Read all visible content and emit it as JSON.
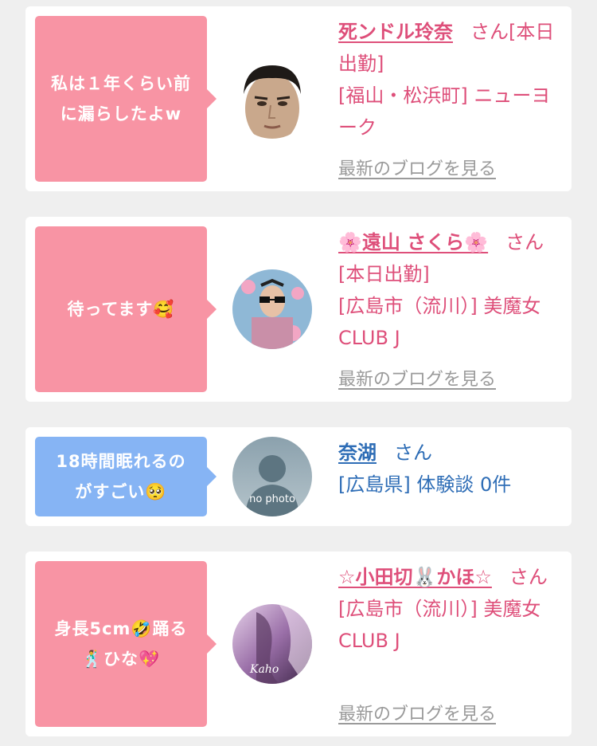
{
  "cards": [
    {
      "message": "私は１年くらい前\nに漏らしたよw",
      "name": "死ンドル玲奈",
      "honorific": "さん",
      "status": "[本日出勤]",
      "location": "[福山・松浜町] ニューヨーク",
      "blog_link": "最新のブログを見る"
    },
    {
      "message": "待ってます🥰",
      "name": "🌸遠山 さくら🌸",
      "honorific": "さん",
      "status": "[本日出勤]",
      "location": "[広島市（流川）] 美魔女CLUB J",
      "blog_link": "最新のブログを見る"
    },
    {
      "message": "18時間眠れるの\nがすごい🥺",
      "name": "奈湖",
      "honorific": "さん",
      "detail": "[広島県] 体験談 0件",
      "avatar_text": "no photo"
    },
    {
      "message": "身長5cm🤣踊る\n🕺ひな💖",
      "name": "☆小田切🐰かほ☆",
      "honorific": "さん",
      "location": "[広島市（流川）] 美魔女CLUB J",
      "blog_link": "最新のブログを見る",
      "avatar_text": "Kaho"
    }
  ],
  "colors": {
    "accent_pink": "#de4f7a",
    "bubble_pink": "#f894a4",
    "bubble_blue": "#86b4f4",
    "link_blue": "#2e6db6"
  }
}
